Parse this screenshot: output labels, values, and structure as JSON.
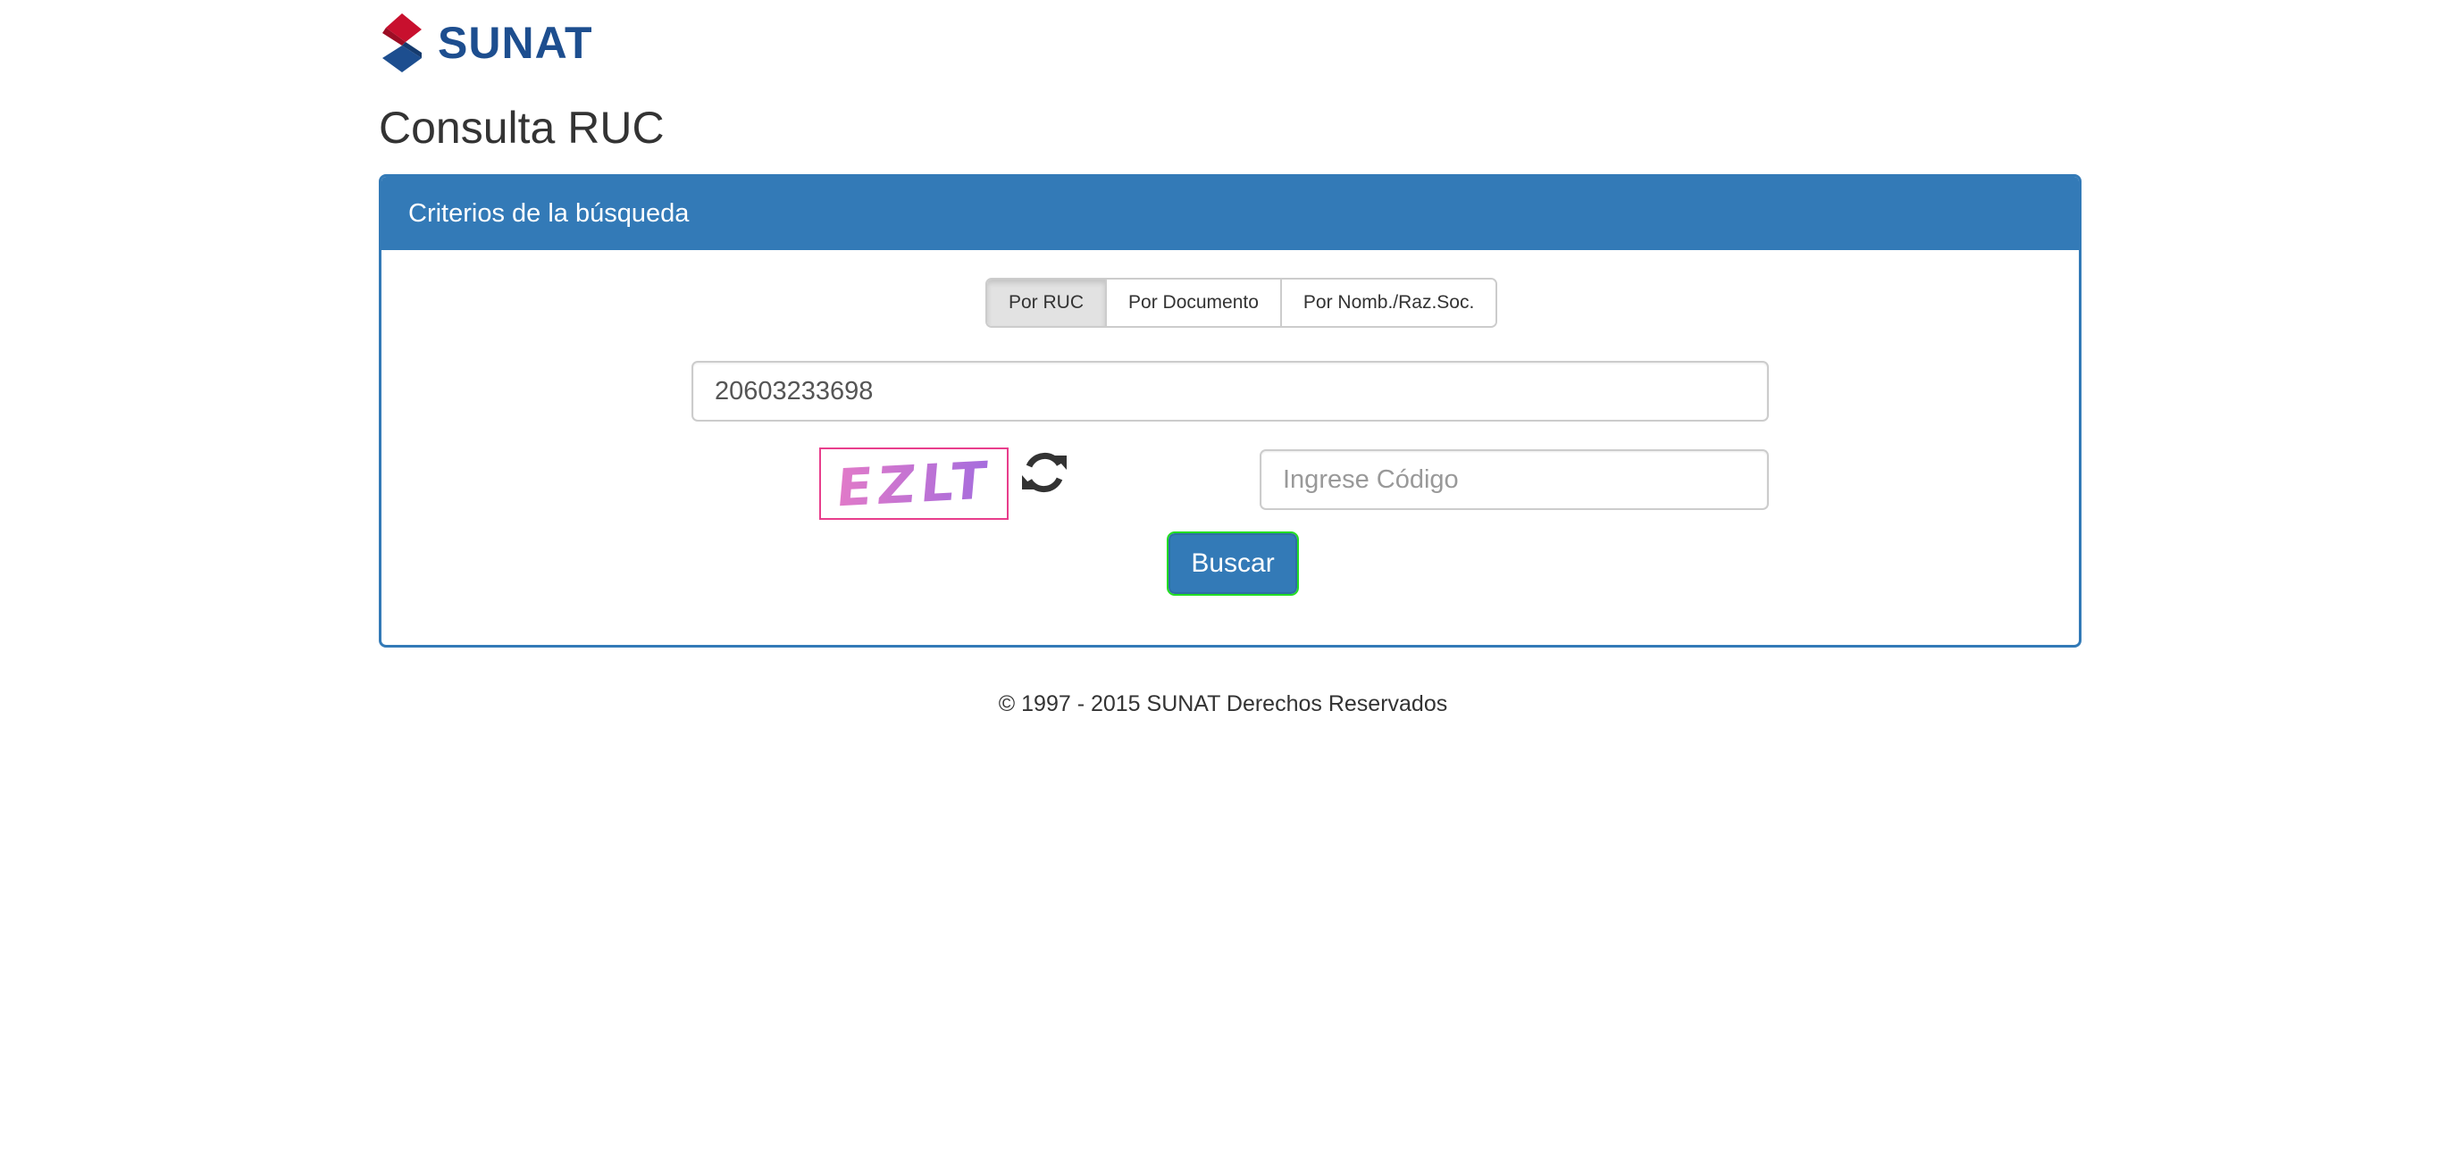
{
  "brand": {
    "logo_text": "SUNAT",
    "colors": {
      "red": "#c8102e",
      "blue": "#1d4e8f"
    }
  },
  "page_title": "Consulta RUC",
  "panel": {
    "heading": "Criterios de la búsqueda",
    "accent_color": "#337ab7"
  },
  "search_tabs": [
    {
      "label": "Por RUC",
      "active": true
    },
    {
      "label": "Por Documento",
      "active": false
    },
    {
      "label": "Por Nomb./Raz.Soc.",
      "active": false
    }
  ],
  "ruc_input": {
    "value": "20603233698",
    "placeholder": ""
  },
  "captcha": {
    "text": "EZLT",
    "refresh_icon": "refresh-icon"
  },
  "code_input": {
    "value": "",
    "placeholder": "Ingrese Código"
  },
  "search_button": {
    "label": "Buscar"
  },
  "footer": {
    "text": "© 1997 - 2015 SUNAT Derechos Reservados"
  }
}
